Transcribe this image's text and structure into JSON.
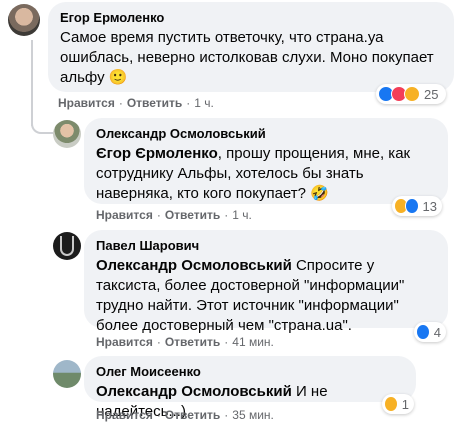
{
  "comments": [
    {
      "author": "Егор Ермоленко",
      "text": "Самое время пустить ответочку, что страна.уа ошиблась, неверно истолковав слухи. Моно покупает альфу 🙂",
      "like_label": "Нравится",
      "reply_label": "Ответить",
      "time": "1 ч.",
      "reaction_count": "25"
    },
    {
      "author": "Олександр Осмоловський",
      "mention": "Єгор Єрмоленко",
      "text": ", прошу прощения, мне, как сотруднику Альфы, хотелось бы знать наверняка, кто кого покупает? 🤣",
      "like_label": "Нравится",
      "reply_label": "Ответить",
      "time": "1 ч.",
      "reaction_count": "13"
    },
    {
      "author": "Павел Шарович",
      "mention": "Олександр Осмоловський",
      "text": " Спросите у таксиста, более достоверной \"информации\" трудно найти. Этот источник \"информации\" более достоверный чем \"страна.ua\".",
      "like_label": "Нравится",
      "reply_label": "Ответить",
      "time": "41 мин.",
      "reaction_count": "4"
    },
    {
      "author": "Олег Моисеенко",
      "mention": "Олександр Осмоловський",
      "text": " И не надейтесь...)",
      "like_label": "Нравится",
      "reply_label": "Ответить",
      "time": "35 мин.",
      "reaction_count": "1"
    }
  ],
  "colors": {
    "like_blue": "#1877f2",
    "love_red": "#f33e58",
    "haha_yellow": "#f7b125",
    "bubble_bg": "#f0f2f5",
    "meta_gray": "#65676b"
  }
}
